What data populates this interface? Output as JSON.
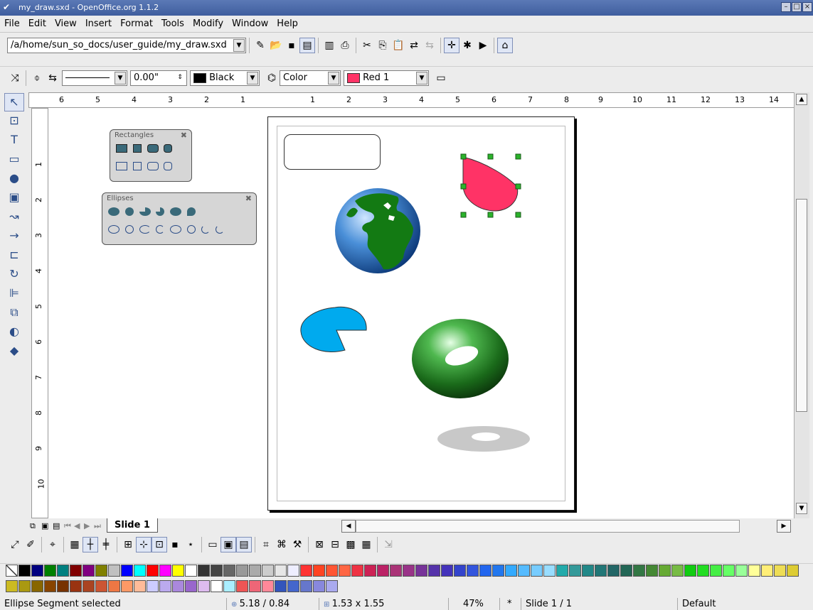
{
  "window": {
    "title": "my_draw.sxd - OpenOffice.org 1.1.2"
  },
  "menu": [
    "File",
    "Edit",
    "View",
    "Insert",
    "Format",
    "Tools",
    "Modify",
    "Window",
    "Help"
  ],
  "function_bar": {
    "path": "/a/home/sun_so_docs/user_guide/my_draw.sxd"
  },
  "object_bar": {
    "line_width": "0.00\"",
    "line_color": "Black",
    "area_style": "Color",
    "area_color": "Red 1"
  },
  "ruler_h_labels": [
    "6",
    "5",
    "4",
    "3",
    "2",
    "1",
    "1",
    "2",
    "3",
    "4",
    "5",
    "6",
    "7",
    "8",
    "9",
    "10",
    "11",
    "12",
    "13",
    "14"
  ],
  "ruler_v_labels": [
    "1",
    "2",
    "3",
    "4",
    "5",
    "6",
    "7",
    "8",
    "9",
    "10"
  ],
  "palettes": {
    "rectangles": {
      "title": "Rectangles"
    },
    "ellipses": {
      "title": "Ellipses"
    }
  },
  "tabs": {
    "slide": "Slide 1"
  },
  "status": {
    "message": "Ellipse Segment selected",
    "position": "5.18 / 0.84",
    "size": "1.53 x 1.55",
    "zoom": "47%",
    "modified": "*",
    "slide": "Slide 1 / 1",
    "layout": "Default"
  },
  "colors": {
    "accent": "#3f5e9e",
    "red1": "#ff3366",
    "globe_ocean": "#4a8fd8",
    "globe_land": "#1a7a1a",
    "pie": "#00aaee",
    "torus": "#1f7a1f",
    "shadow": "#c8c8c8"
  },
  "palette_colors": [
    "#000000",
    "#000080",
    "#008000",
    "#008080",
    "#800000",
    "#800080",
    "#808000",
    "#c0c0c0",
    "#0000ff",
    "#00ffff",
    "#ff0000",
    "#ff00ff",
    "#ffff00",
    "#ffffff",
    "#333333",
    "#444444",
    "#666666",
    "#999999",
    "#aaaaaa",
    "#cccccc",
    "#e6e6e6",
    "#eeeeff",
    "#ff3333",
    "#ff4422",
    "#ff5533",
    "#ff6644",
    "#ee3344",
    "#cc2255",
    "#bb2266",
    "#aa3377",
    "#993388",
    "#773399",
    "#5533aa",
    "#4433bb",
    "#3344cc",
    "#3355dd",
    "#2266ee",
    "#2277ee",
    "#33aaff",
    "#55bbff",
    "#77ccff",
    "#99ddff",
    "#22aaaa",
    "#339999",
    "#228888",
    "#227777",
    "#226666",
    "#226655",
    "#337744",
    "#448833",
    "#66aa33",
    "#77bb44",
    "#11cc11",
    "#22dd22",
    "#44ee44",
    "#66ff66",
    "#99ff99",
    "#ffff99",
    "#ffee77",
    "#eedd55",
    "#ddcc33",
    "#ccbb22",
    "#aa9911",
    "#886600",
    "#884400",
    "#773300",
    "#993311",
    "#aa4422",
    "#cc5533",
    "#ee7744",
    "#ff9966",
    "#ffbb99",
    "#ccccff",
    "#bbaaee",
    "#aa88dd",
    "#9966cc",
    "#ddbbee",
    "#ffffff",
    "#aaeeff",
    "#ee5555",
    "#ee6677",
    "#ff8899",
    "#3355bb",
    "#4466cc",
    "#6677cc",
    "#8888dd",
    "#aaaaee"
  ]
}
